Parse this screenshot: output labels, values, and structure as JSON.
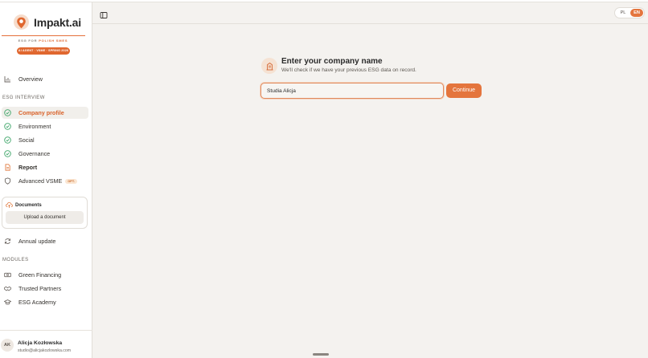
{
  "brand": {
    "name": "Impakt.ai",
    "tagline_prefix": "ESG FOR ",
    "tagline_highlight": "POLISH SMES",
    "event_badge": "AI AGENT · VSME · SPRING 2026",
    "accent_color": "#e4753d"
  },
  "sidebar": {
    "overview": {
      "label": "Overview",
      "icon": "bar-chart-icon"
    },
    "esg_interview_label": "ESG INTERVIEW",
    "interview_items": [
      {
        "label": "Company profile",
        "icon": "check-circle-icon",
        "state": "active"
      },
      {
        "label": "Environment",
        "icon": "check-circle-icon",
        "state": "done"
      },
      {
        "label": "Social",
        "icon": "check-circle-icon",
        "state": "done"
      },
      {
        "label": "Governance",
        "icon": "check-circle-icon",
        "state": "done"
      },
      {
        "label": "Report",
        "icon": "document-icon",
        "state": "bold"
      },
      {
        "label": "Advanced VSME",
        "icon": "shield-icon",
        "badge": "OPT."
      }
    ],
    "documents": {
      "title": "Documents",
      "icon": "cloud-upload-icon",
      "upload_label": "Upload a document"
    },
    "annual_update": {
      "label": "Annual update",
      "icon": "refresh-icon"
    },
    "modules_label": "MODULES",
    "modules": [
      {
        "label": "Green Financing",
        "icon": "banknote-icon"
      },
      {
        "label": "Trusted Partners",
        "icon": "handshake-icon"
      },
      {
        "label": "ESG Academy",
        "icon": "graduation-cap-icon"
      }
    ],
    "user": {
      "initials": "AK",
      "name": "Alicja Kozłowska",
      "email": "studio@alicjakozlowska.com"
    }
  },
  "topbar": {
    "toggle_icon": "sidebar-toggle-icon",
    "lang_options": [
      "PL",
      "EN"
    ],
    "lang_selected": "EN"
  },
  "main": {
    "icon": "building-icon",
    "heading": "Enter your company name",
    "subheading": "We'll check if we have your previous ESG data on record.",
    "company_input_value": "Studia Alicja",
    "continue_label": "Continue"
  }
}
